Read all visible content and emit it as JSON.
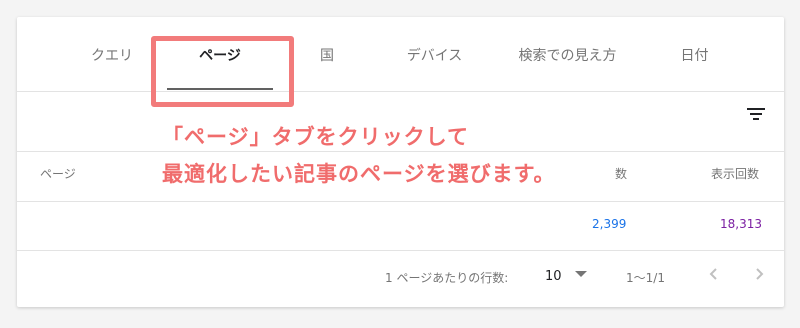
{
  "tabs": [
    {
      "label": "クエリ"
    },
    {
      "label": "ページ"
    },
    {
      "label": "国"
    },
    {
      "label": "デバイス"
    },
    {
      "label": "検索での見え方"
    },
    {
      "label": "日付"
    }
  ],
  "table": {
    "headers": {
      "page": "ページ",
      "clicks": "数",
      "impressions": "表示回数"
    },
    "row": {
      "clicks": "2,399",
      "impressions": "18,313"
    }
  },
  "annotation": {
    "line1": "「ページ」タブをクリックして",
    "line2": "最適化したい記事のページを選びます。"
  },
  "pagination": {
    "rows_label": "1 ページあたりの行数:",
    "rows_value": "10",
    "range": "1〜1/1"
  },
  "colors": {
    "clicks": "#1a73e8",
    "impressions": "#7b1fa2",
    "annotation": "#f06c6c"
  }
}
